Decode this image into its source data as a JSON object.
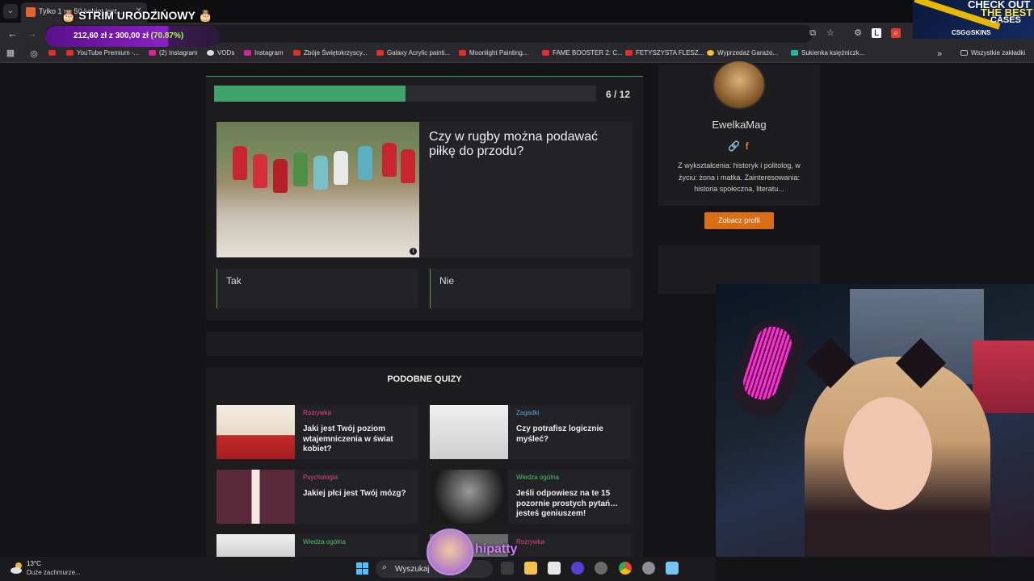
{
  "browser": {
    "tab_title": "Tylko 1 na 50 kobiet jest ...",
    "bookmarks": [
      {
        "label": "YouTube Premium -...",
        "color": "#e52d27"
      },
      {
        "label": "(2) Instagram",
        "color": "#d6249f"
      },
      {
        "label": "VODs",
        "color": "#dddddd"
      },
      {
        "label": "Instagram",
        "color": "#d6249f"
      },
      {
        "label": "Zbóje Świętokrzyscy...",
        "color": "#e52d27"
      },
      {
        "label": "Galaxy Acrylic painti...",
        "color": "#e52d27"
      },
      {
        "label": "Moonlight Painting...",
        "color": "#e52d27"
      },
      {
        "label": "FAME BOOSTER 2: C...",
        "color": "#e52d27"
      },
      {
        "label": "FETYSZYSTA FLESZ...",
        "color": "#e52d27"
      },
      {
        "label": "Wyprzedaż Garażo...",
        "color": "#f0c02a"
      },
      {
        "label": "Sukienka księżniczk...",
        "color": "#22b8a8"
      }
    ],
    "all_bookmarks_label": "Wszystkie zakładki"
  },
  "overlay": {
    "stream_title": "🎂 STRIM URODZIŃOWY 🎂",
    "goal_text": "212,60 zł z 300,00 zł",
    "goal_percent": "(70.87%)",
    "goal_fraction": 0.7087,
    "ad": {
      "line1": "CHECK OUT",
      "line2": "THE BEST",
      "line3": "CASES",
      "brand": "CSG⊙SKINS"
    },
    "chatter_name": "hipatty"
  },
  "quiz": {
    "progress_label": "6 / 12",
    "progress_fraction": 0.5,
    "question": "Czy w rugby można podawać piłkę do przodu?",
    "answers": [
      "Tak",
      "Nie"
    ]
  },
  "similar": {
    "heading": "PODOBNE QUIZY",
    "items": [
      {
        "category": "Rozrywka",
        "category_color": "#e0487a",
        "title": "Jaki jest Twój poziom wtajemniczenia w świat kobiet?"
      },
      {
        "category": "Zagadki",
        "category_color": "#5aa0e0",
        "title": "Czy potrafisz logicznie myśleć?"
      },
      {
        "category": "Psychologia",
        "category_color": "#e0487a",
        "title": "Jakiej płci jest Twój mózg?"
      },
      {
        "category": "Wiedza ogólna",
        "category_color": "#4ec070",
        "title": "Jeśli odpowiesz na te 15 pozornie prostych pytań… jesteś geniuszem!"
      },
      {
        "category": "Wiedza ogólna",
        "category_color": "#4ec070",
        "title": ""
      },
      {
        "category": "Rozrywka",
        "category_color": "#e0487a",
        "title": ""
      }
    ]
  },
  "author": {
    "name": "EwelkaMag",
    "bio": "Z wykształcenia: historyk i politolog, w życiu: żona i matka. Zainteresowania: historia społeczna, literatu...",
    "profile_button": "Zobacz profil"
  },
  "taskbar": {
    "temperature": "13°C",
    "weather": "Duże zachmurze...",
    "search_label": "Wyszukaj"
  },
  "colors": {
    "accent_green": "#3ea26b",
    "accent_orange": "#d96e14",
    "page_bg": "#141416"
  }
}
